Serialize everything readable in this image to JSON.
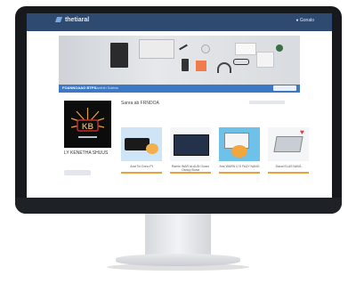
{
  "app": {
    "logo_text": "thetiaral",
    "top_right_text": "Gonalo"
  },
  "nav": {
    "label": "FOANNOAAG BTPS",
    "sub": "Sanfnlh Saitms"
  },
  "seller": {
    "name": "LY KENETHA SHUUS"
  },
  "section": {
    "title": "Sanra ab FRNDOA"
  },
  "products": [
    {
      "name": "Arat Toi Dono Pt"
    },
    {
      "name": "Ramin WAR ALAUN Ouaro Oanop Burat"
    },
    {
      "name": "Ane WARN U S FA3Y NANG"
    },
    {
      "name": "Davai ELAS NAVA"
    }
  ],
  "colors": {
    "topbar": "#2f4a70",
    "accent": "#3d78c4",
    "price": "#e7a240"
  },
  "icons": [
    "brand-logo-icon",
    "user-icon",
    "kb-sunburst-logo-icon",
    "heart-icon"
  ]
}
